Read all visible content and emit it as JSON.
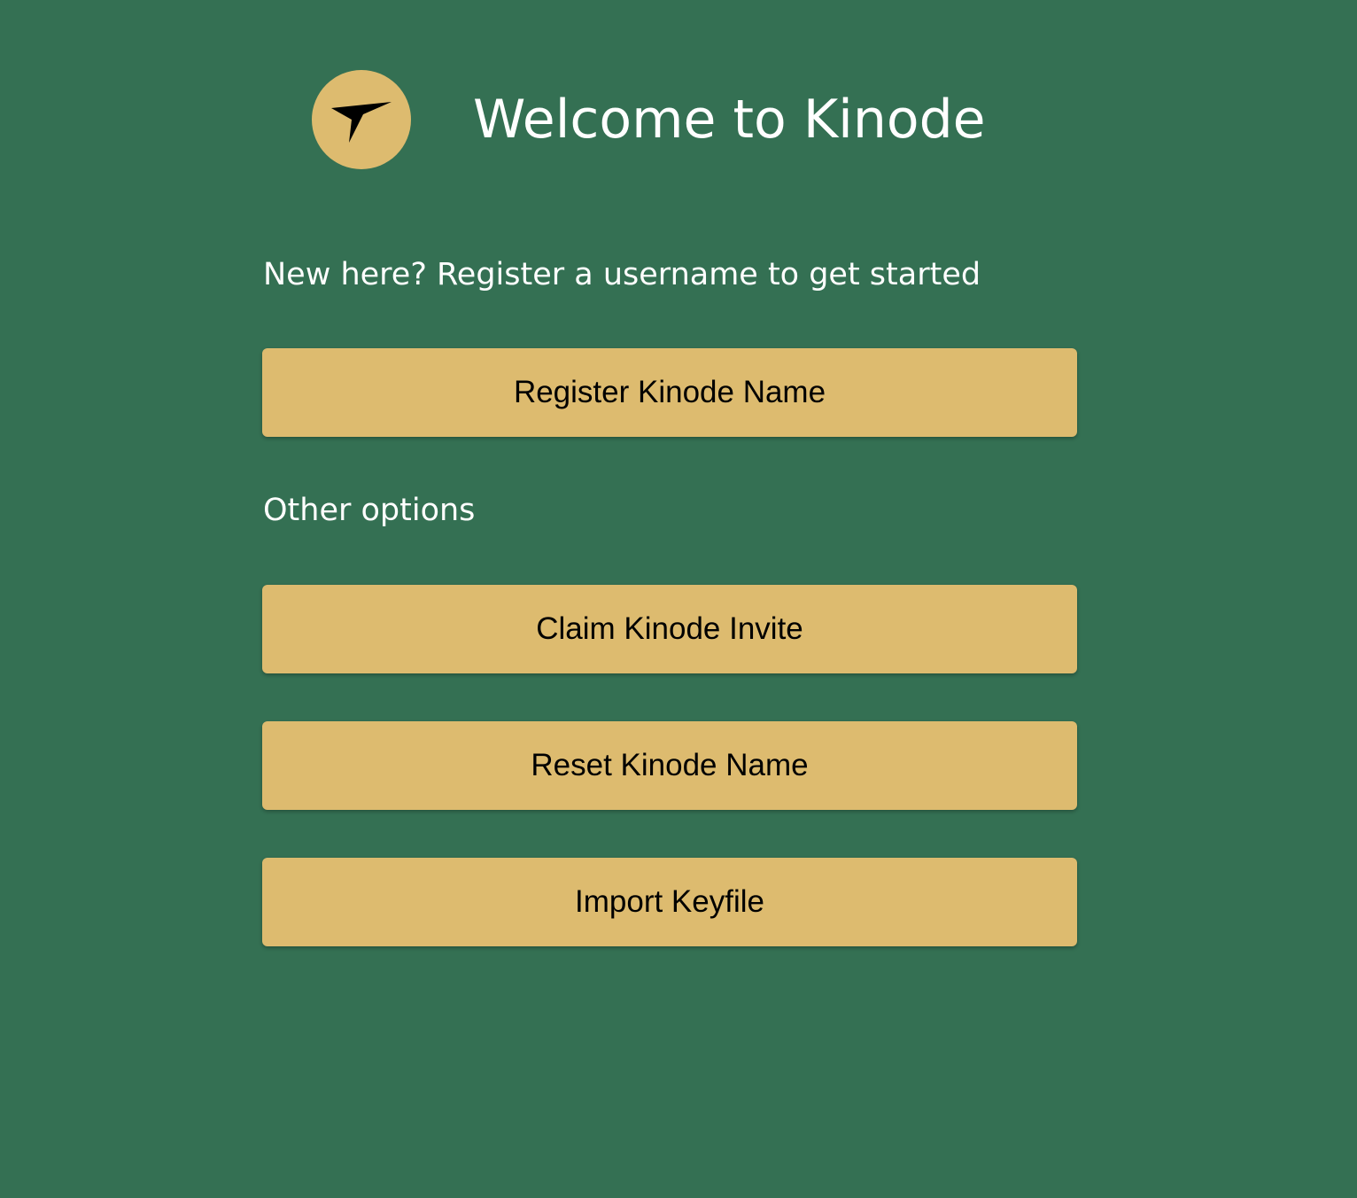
{
  "header": {
    "logo_icon": "kinode-bird-logo-icon",
    "title": "Welcome to Kinode"
  },
  "intro": {
    "text": "New here? Register a username to get started"
  },
  "primary_action": {
    "label": "Register Kinode Name"
  },
  "other_options": {
    "heading": "Other options",
    "buttons": [
      {
        "label": "Claim Kinode Invite"
      },
      {
        "label": "Reset Kinode Name"
      },
      {
        "label": "Import Keyfile"
      }
    ]
  },
  "colors": {
    "background": "#347053",
    "accent": "#ddbb6f",
    "text_light": "#ffffff",
    "text_dark": "#000000"
  }
}
